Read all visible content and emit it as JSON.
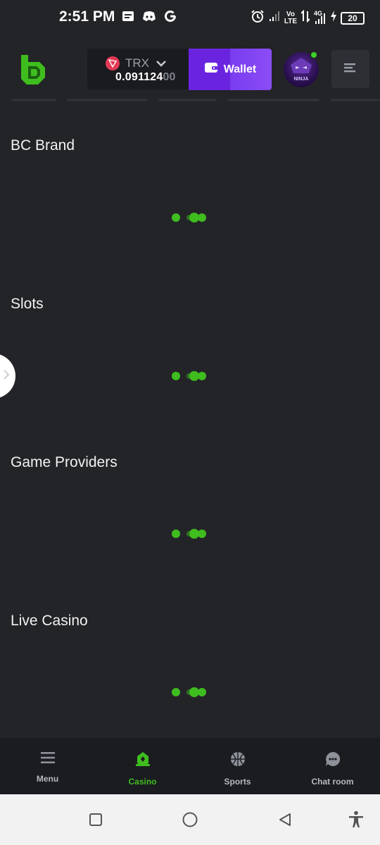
{
  "status_bar": {
    "time": "2:51 PM",
    "volte": "Vo\nLTE",
    "net": "4G",
    "battery": "20"
  },
  "header": {
    "currency": "TRX",
    "balance_main": "0.091124",
    "balance_dim": "00",
    "wallet_label": "Wallet",
    "avatar_text": "NINJA"
  },
  "sections": [
    {
      "title": "BC Brand"
    },
    {
      "title": "Slots"
    },
    {
      "title": "Game Providers"
    },
    {
      "title": "Live Casino"
    }
  ],
  "bottom_nav": {
    "items": [
      {
        "label": "Menu",
        "icon": "menu-icon",
        "active": false
      },
      {
        "label": "Casino",
        "icon": "casino-icon",
        "active": true
      },
      {
        "label": "Sports",
        "icon": "basketball-icon",
        "active": false
      },
      {
        "label": "Chat room",
        "icon": "chat-icon",
        "active": false
      }
    ]
  },
  "colors": {
    "background": "#232428",
    "accent_green": "#3fbd1f",
    "wallet_purple": "#6a24e0",
    "trx_red": "#e23a55"
  }
}
